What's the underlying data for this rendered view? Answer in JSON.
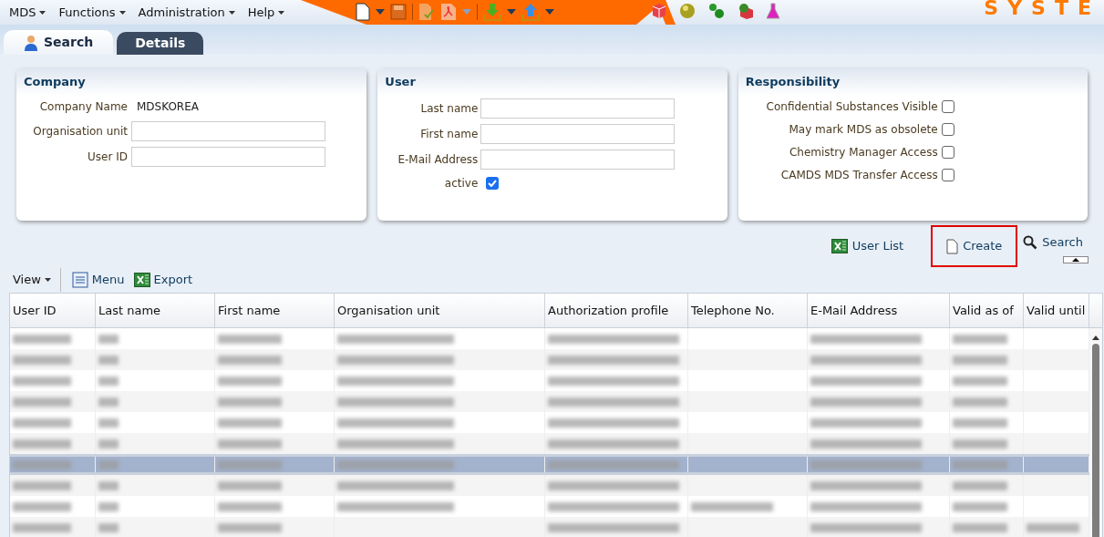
{
  "menu": [
    {
      "label": "MDS"
    },
    {
      "label": "Functions"
    },
    {
      "label": "Administration"
    },
    {
      "label": "Help"
    }
  ],
  "logo": "SYSTE",
  "tabs": [
    {
      "label": "Search",
      "selected": true
    },
    {
      "label": "Details",
      "selected": false
    }
  ],
  "company": {
    "title": "Company",
    "name_label": "Company Name",
    "name_value": "MDSKOREA",
    "fields": [
      {
        "label": "Organisation unit"
      },
      {
        "label": "User ID"
      }
    ]
  },
  "user": {
    "title": "User",
    "fields": [
      {
        "label": "Last name"
      },
      {
        "label": "First name"
      },
      {
        "label": "E-Mail Address"
      }
    ],
    "active": {
      "label": "active",
      "checked": true
    }
  },
  "responsibility": {
    "title": "Responsibility",
    "options": [
      {
        "label": "Confidential Substances Visible",
        "checked": false
      },
      {
        "label": "May mark MDS as obsolete",
        "checked": false
      },
      {
        "label": "Chemistry Manager Access",
        "checked": false
      },
      {
        "label": "CAMDS MDS Transfer Access",
        "checked": false
      }
    ]
  },
  "actions": [
    {
      "label": "User List",
      "kind": "excel",
      "highlighted": false
    },
    {
      "label": "Create",
      "kind": "page",
      "highlighted": true
    },
    {
      "label": "Search",
      "kind": "search",
      "highlighted": false
    }
  ],
  "table_toolbar": [
    {
      "label": "View",
      "kind": "dropdown"
    },
    {
      "label": "Menu",
      "kind": "menu"
    },
    {
      "label": "Export",
      "kind": "excel"
    }
  ],
  "table": {
    "columns": [
      "User ID",
      "Last name",
      "First name",
      "Organisation unit",
      "Authorization profile",
      "Telephone No.",
      "E-Mail Address",
      "Valid as of",
      "Valid until"
    ],
    "rows": [
      {
        "selected": false,
        "redacted": [
          true,
          true,
          true,
          true,
          true,
          false,
          true,
          true,
          false
        ]
      },
      {
        "selected": false,
        "redacted": [
          true,
          true,
          true,
          true,
          true,
          false,
          true,
          true,
          false
        ]
      },
      {
        "selected": false,
        "redacted": [
          true,
          true,
          true,
          true,
          true,
          false,
          true,
          true,
          false
        ]
      },
      {
        "selected": false,
        "redacted": [
          true,
          true,
          true,
          true,
          true,
          false,
          true,
          true,
          false
        ]
      },
      {
        "selected": false,
        "redacted": [
          true,
          true,
          true,
          true,
          true,
          false,
          true,
          true,
          false
        ]
      },
      {
        "selected": false,
        "redacted": [
          true,
          true,
          true,
          true,
          true,
          false,
          true,
          true,
          false
        ]
      },
      {
        "selected": true,
        "redacted": [
          true,
          true,
          true,
          true,
          true,
          false,
          true,
          true,
          false
        ]
      },
      {
        "selected": false,
        "redacted": [
          true,
          true,
          true,
          true,
          true,
          false,
          true,
          true,
          false
        ]
      },
      {
        "selected": false,
        "redacted": [
          true,
          true,
          true,
          true,
          true,
          true,
          true,
          true,
          false
        ]
      },
      {
        "selected": false,
        "redacted": [
          true,
          true,
          true,
          false,
          true,
          false,
          true,
          true,
          true
        ]
      }
    ]
  }
}
